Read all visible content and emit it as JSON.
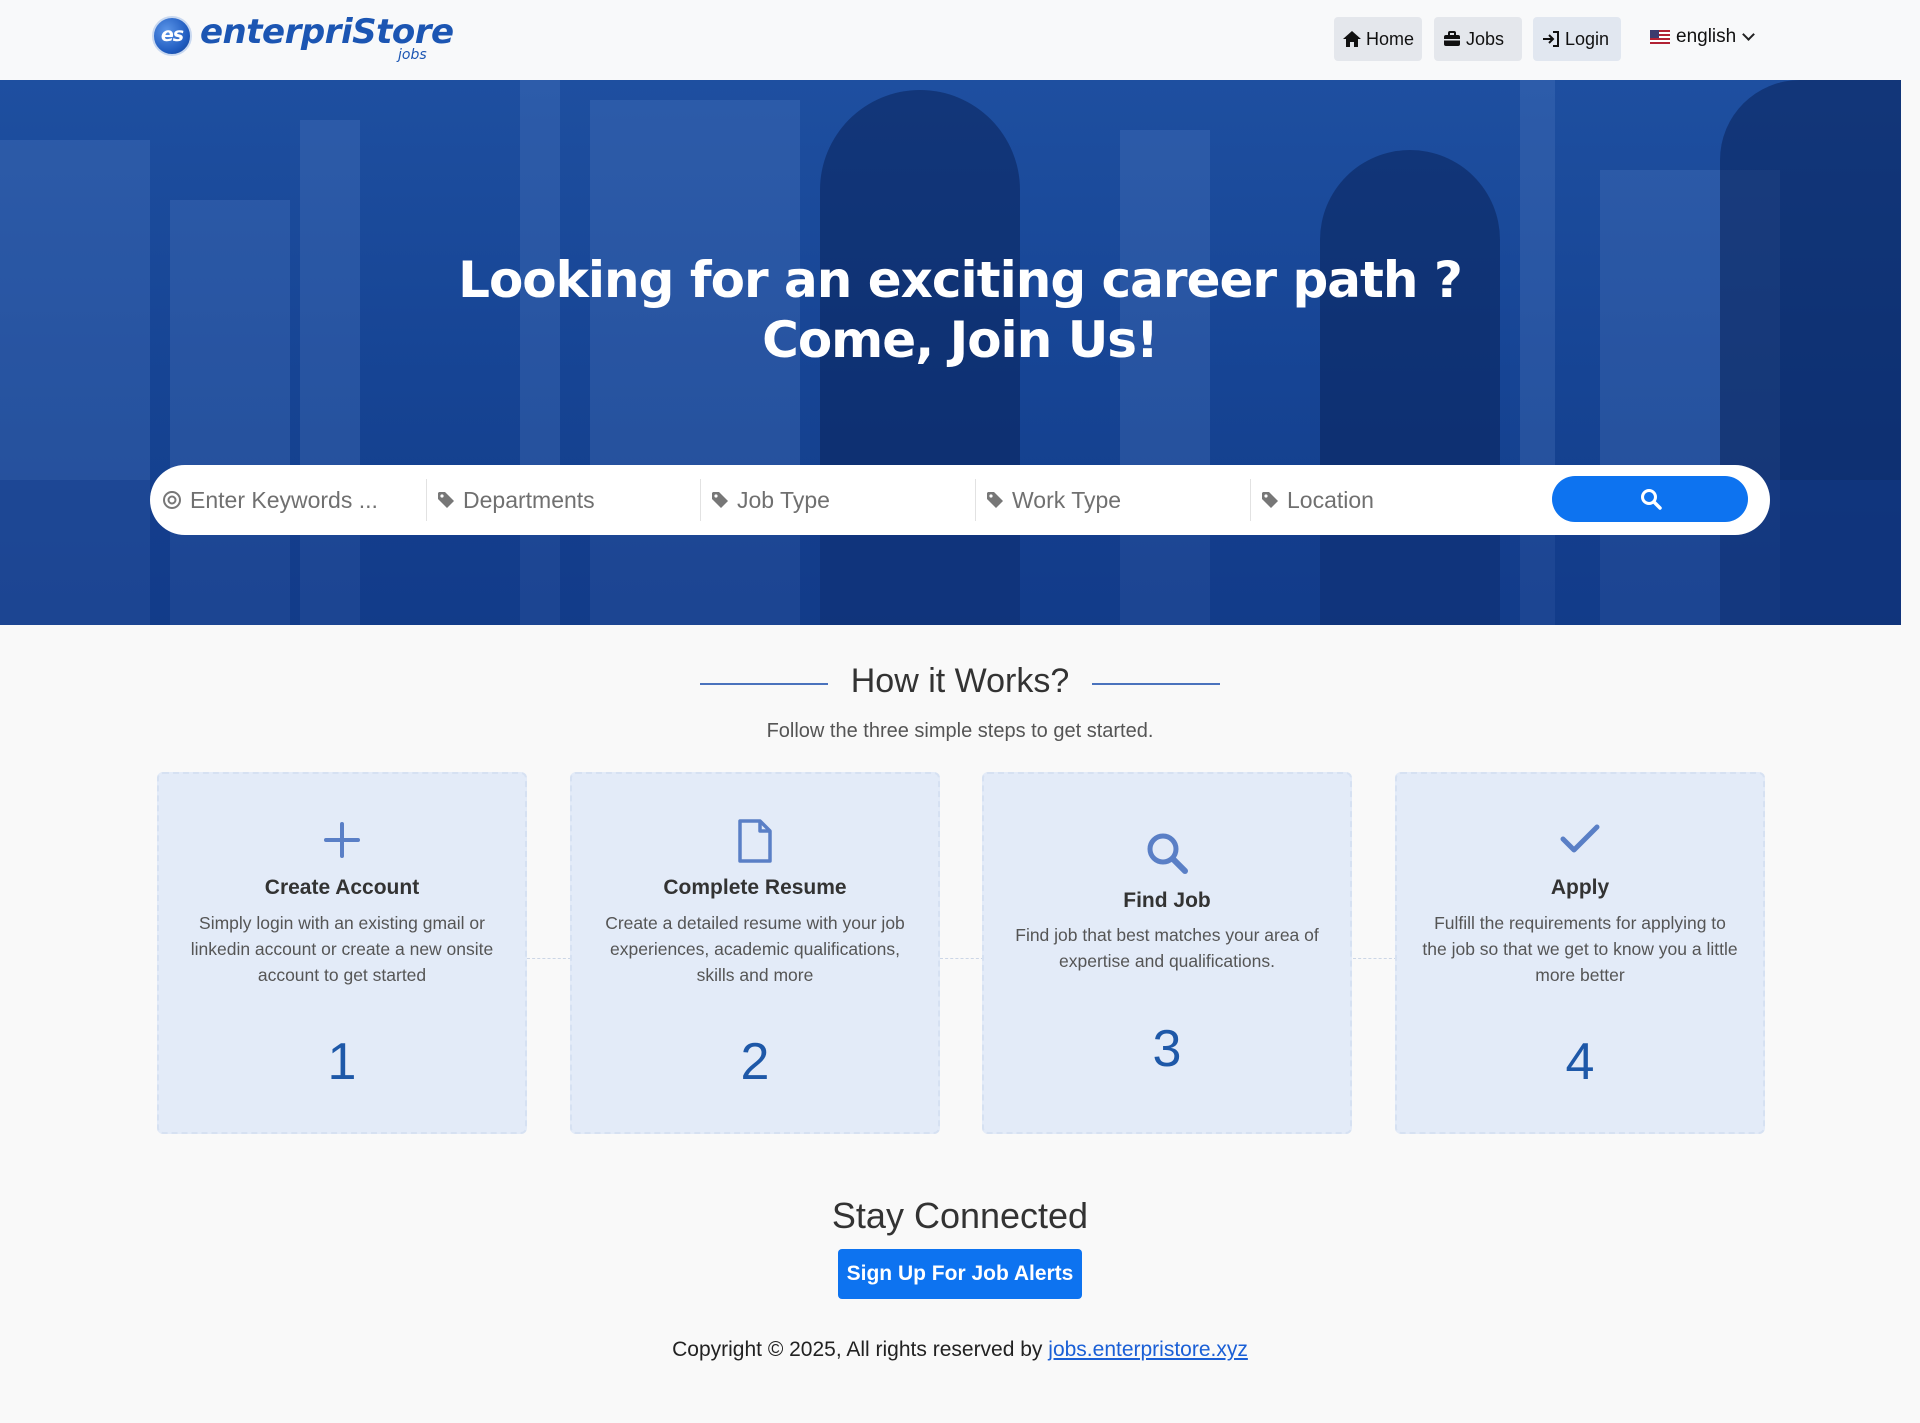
{
  "header": {
    "logo_badge": "es",
    "logo_word": "enterpriStore",
    "logo_sub": "jobs",
    "nav": {
      "home": "Home",
      "jobs": "Jobs",
      "login": "Login"
    },
    "language": "english"
  },
  "hero": {
    "line1": "Looking for an exciting career path ?",
    "line2": "Come, Join Us!"
  },
  "search": {
    "keywords_placeholder": "Enter Keywords ...",
    "departments": "Departments",
    "job_type": "Job Type",
    "work_type": "Work Type",
    "location": "Location"
  },
  "how_it_works": {
    "title": "How it Works?",
    "subtitle": "Follow the three simple steps to get started.",
    "steps": [
      {
        "icon": "plus-icon",
        "title": "Create Account",
        "desc": "Simply login with an existing gmail or linkedin account or create a new onsite account to get started",
        "number": "1"
      },
      {
        "icon": "file-icon",
        "title": "Complete Resume",
        "desc": "Create a detailed resume with your job experiences, academic qualifications, skills and more",
        "number": "2"
      },
      {
        "icon": "search-icon",
        "title": "Find Job",
        "desc": "Find job that best matches your area of expertise and qualifications.",
        "number": "3"
      },
      {
        "icon": "check-icon",
        "title": "Apply",
        "desc": "Fulfill the requirements for applying to the job so that we get to know you a little more better",
        "number": "4"
      }
    ]
  },
  "stay_connected": {
    "title": "Stay Connected",
    "button": "Sign Up For Job Alerts"
  },
  "footer": {
    "copyright": "Copyright © 2025, All rights reserved by",
    "link": "jobs.enterpristore.xyz"
  },
  "colors": {
    "primary": "#0d73f0",
    "hero": "#164494",
    "card": "#e3ebf8"
  }
}
